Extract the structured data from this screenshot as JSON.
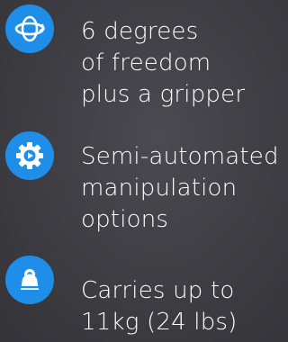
{
  "features": [
    {
      "icon": "rotation-axes-icon",
      "lines": [
        "6 degrees",
        "of freedom",
        "plus a gripper"
      ]
    },
    {
      "icon": "gear-play-icon",
      "lines": [
        "Semi-automated",
        "manipulation",
        "options"
      ]
    },
    {
      "icon": "weight-icon",
      "lines": [
        "Carries up to",
        "11kg (24 lbs)"
      ]
    }
  ],
  "colors": {
    "accent": "#1e8ee8",
    "text": "#ffffff",
    "background": "#3d3d42"
  }
}
